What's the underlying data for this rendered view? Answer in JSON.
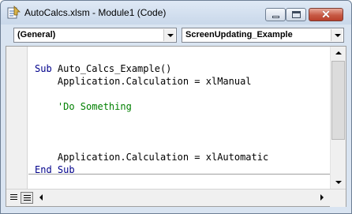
{
  "window": {
    "title": "AutoCalcs.xlsm - Module1 (Code)",
    "close_glyph": "✕"
  },
  "combos": {
    "object": "(General)",
    "procedure": "ScreenUpdating_Example"
  },
  "code": {
    "lines": [
      {
        "keyword": "Sub",
        "text": " Auto_Calcs_Example()"
      },
      {
        "text": "    Application.Calculation = xlManual"
      },
      {
        "comment": "    'Do Something"
      },
      {
        "text": "    Application.Calculation = xlAutomatic"
      },
      {
        "keyword": "End Sub",
        "text": ""
      }
    ]
  },
  "colors": {
    "keyword": "#00008b",
    "comment": "#008000",
    "close_button": "#c75a45"
  },
  "icons": {
    "app": "vba-module-icon",
    "procedure_view": "procedure-view-icon",
    "full_module_view": "full-module-view-icon"
  }
}
